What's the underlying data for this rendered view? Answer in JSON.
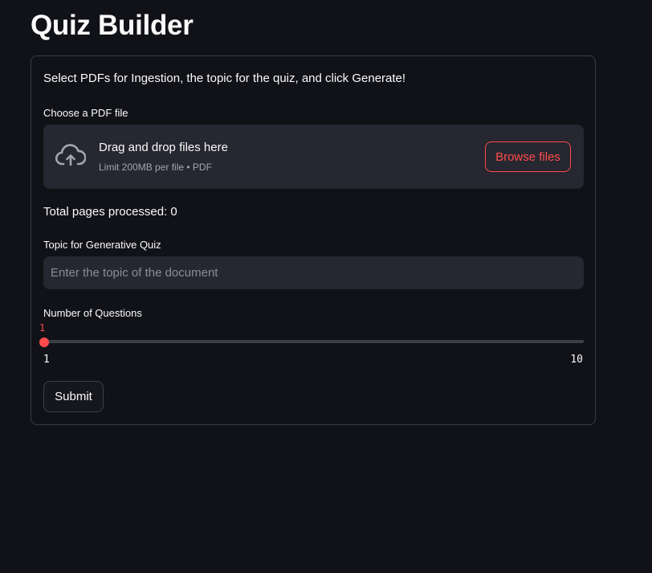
{
  "page": {
    "title": "Quiz Builder"
  },
  "form": {
    "intro": "Select PDFs for Ingestion, the topic for the quiz, and click Generate!",
    "uploader": {
      "label": "Choose a PDF file",
      "icon": "cloud-upload-icon",
      "title": "Drag and drop files here",
      "subtitle": "Limit 200MB per file • PDF",
      "button_label": "Browse files"
    },
    "total_pages": "Total pages processed: 0",
    "topic": {
      "label": "Topic for Generative Quiz",
      "value": "",
      "placeholder": "Enter the topic of the document"
    },
    "questions": {
      "label": "Number of Questions",
      "value": "1",
      "min": "1",
      "max": "10"
    },
    "submit_label": "Submit"
  },
  "colors": {
    "background": "#111217",
    "accent": "#ff4b4b",
    "field_bg": "#262730",
    "border": "#3a3c45"
  }
}
